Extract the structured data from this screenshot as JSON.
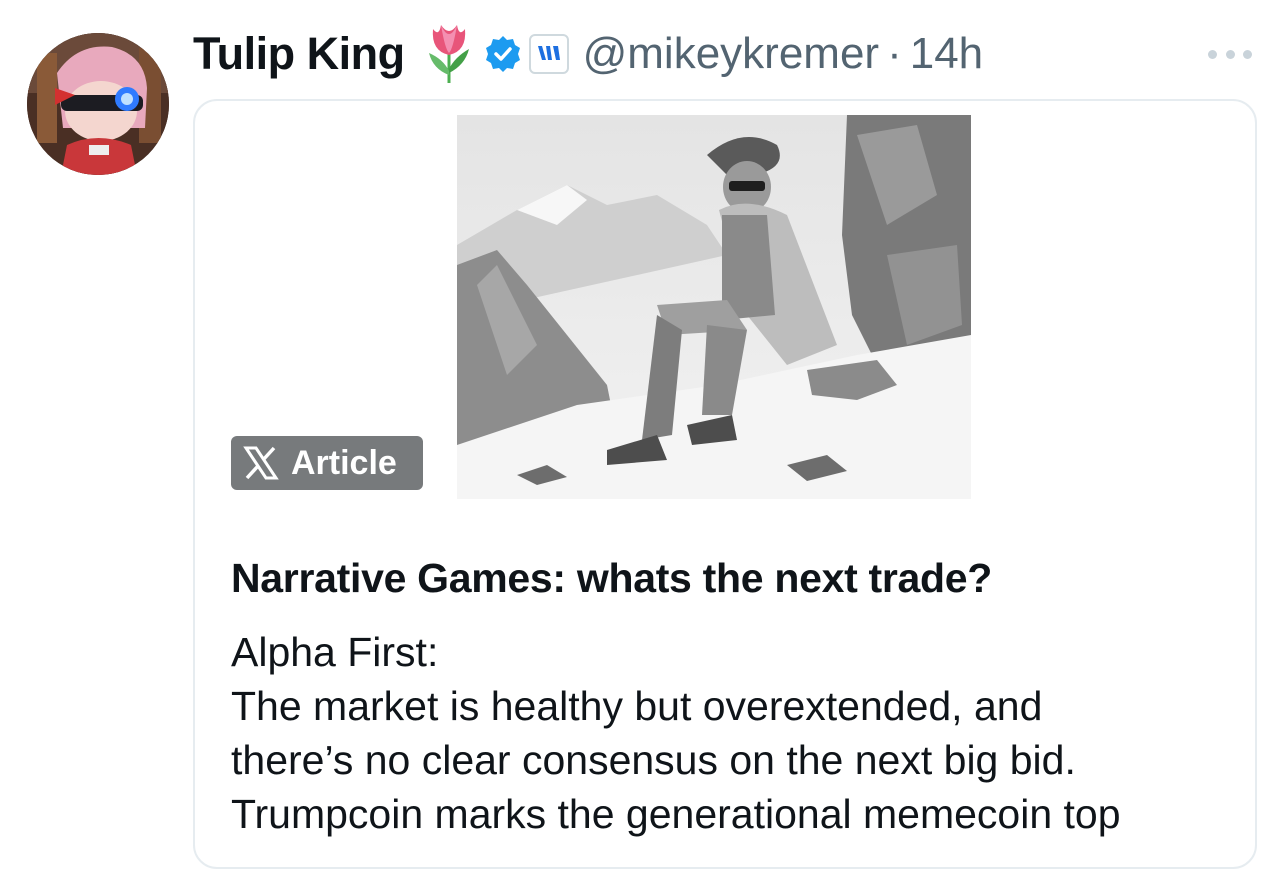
{
  "post": {
    "author": {
      "display_name": "Tulip King",
      "name_emoji": "tulip-icon",
      "verified_badge": "verified-icon",
      "affiliate_badge": "affiliate-badge-icon",
      "handle": "@mikeykremer",
      "separator": "·",
      "time": "14h",
      "avatar": "avatar-image"
    },
    "more_menu_icon": "more-icon"
  },
  "article_card": {
    "badge_label": "Article",
    "badge_icon": "x-logo-icon",
    "image": "armored-knight-sitting-on-snowy-mountain-image",
    "title": "Narrative Games: whats the next trade?",
    "body_lines": [
      "Alpha First:",
      "The market is healthy but overextended, and",
      "there’s no clear consensus on the next big bid.",
      "Trumpcoin marks the generational memecoin top"
    ]
  },
  "colors": {
    "text_primary": "#0f1419",
    "text_secondary": "#536471",
    "verified_blue": "#1d9bf0",
    "card_border": "#e6ecf0",
    "badge_bg": "#777a7c"
  }
}
